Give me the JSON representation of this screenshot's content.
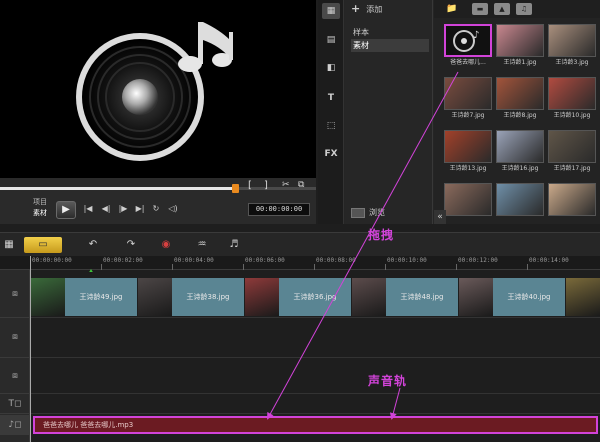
{
  "preview": {
    "mode_project": "项目",
    "mode_clip": "素材",
    "trim_in": "[",
    "trim_out": "]",
    "timecode": "00:00:00:00",
    "progress": 0.75
  },
  "library": {
    "add_label": "添加",
    "folders": [
      "样本",
      "素材"
    ],
    "selected_folder": "素材",
    "browse_label": "浏览",
    "tool_fx": "FX",
    "tool_title": "T",
    "thumbnails": [
      {
        "caption": "爸爸去哪儿...",
        "kind": "music",
        "selected": true,
        "color": "#111111"
      },
      {
        "caption": "王诗龄1.jpg",
        "kind": "photo",
        "color": "#c9878f"
      },
      {
        "caption": "王诗龄3.jpg",
        "kind": "photo",
        "color": "#a98f7d"
      },
      {
        "caption": "王诗龄7.jpg",
        "kind": "photo",
        "color": "#7a4c3f"
      },
      {
        "caption": "王诗龄8.jpg",
        "kind": "photo",
        "color": "#a2543b"
      },
      {
        "caption": "王诗龄10.jpg",
        "kind": "photo",
        "color": "#b14b40"
      },
      {
        "caption": "王诗龄13.jpg",
        "kind": "photo",
        "color": "#a2412a"
      },
      {
        "caption": "王诗龄16.jpg",
        "kind": "photo",
        "color": "#9aa3b8"
      },
      {
        "caption": "王诗龄17.jpg",
        "kind": "photo",
        "color": "#5f5548"
      },
      {
        "caption": "",
        "kind": "photo",
        "color": "#8a6a5c"
      },
      {
        "caption": "",
        "kind": "photo",
        "color": "#6f8fa8"
      },
      {
        "caption": "",
        "kind": "photo",
        "color": "#caa98a"
      }
    ]
  },
  "annotations": {
    "drag": "拖拽",
    "audio_track": "声音轨"
  },
  "timeline": {
    "ruler": [
      "00:00:00:00",
      "00:00:02:00",
      "00:00:04:00",
      "00:00:06:00",
      "00:00:08:00",
      "00:00:10:00",
      "00:00:12:00",
      "00:00:14:00"
    ],
    "video_clips": [
      {
        "label": "王诗龄49.jpg",
        "thumb_color": "#3a6a3a"
      },
      {
        "label": "王诗龄38.jpg",
        "thumb_color": "#4c4646"
      },
      {
        "label": "王诗龄36.jpg",
        "thumb_color": "#8e3a3a"
      },
      {
        "label": "王诗龄48.jpg",
        "thumb_color": "#5c4c4c"
      },
      {
        "label": "王诗龄40.jpg",
        "thumb_color": "#6a5a5a"
      }
    ],
    "audio_clip": "爸爸去哪儿 爸爸去哪儿.mp3"
  },
  "colors": {
    "annotation": "#d243d9",
    "audio_clip": "#6b1b22",
    "video_title": "#5a8593",
    "accent": "#e98a1f"
  },
  "icons": [
    "music-note-icon",
    "play-icon",
    "undo-icon",
    "redo-icon",
    "record-icon",
    "folder-icon"
  ]
}
